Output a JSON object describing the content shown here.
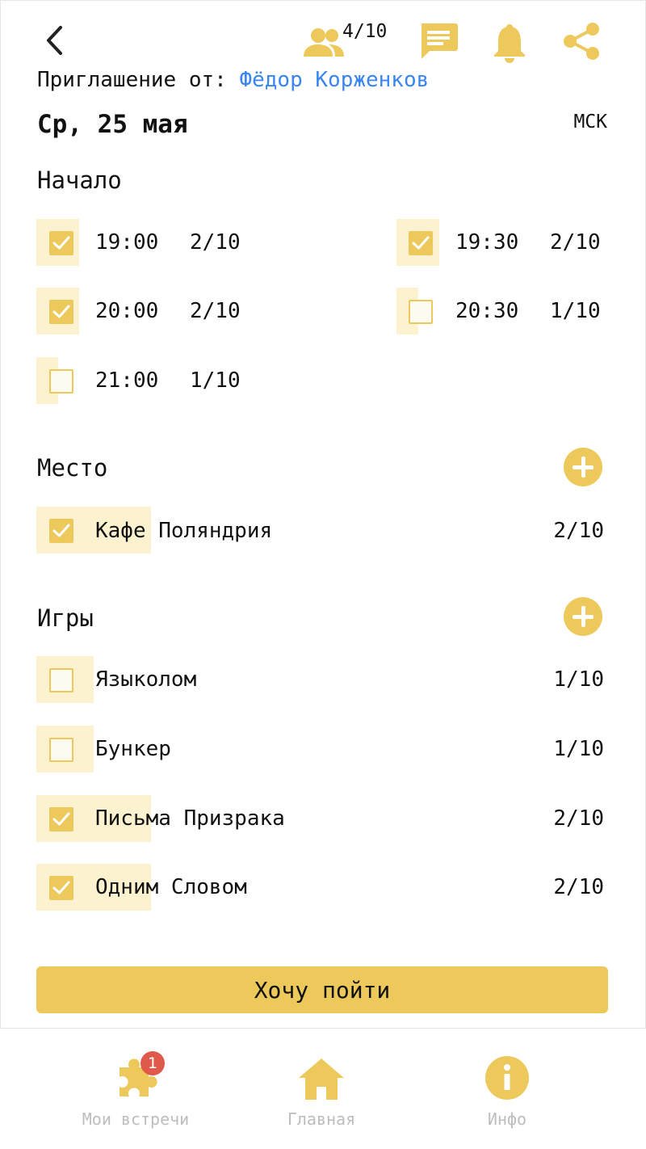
{
  "header": {
    "participants_count": "4/10",
    "icons": [
      "back-chevron-icon",
      "people-icon",
      "chat-icon",
      "bell-icon",
      "share-icon"
    ]
  },
  "invite": {
    "prefix": "Приглашение от:",
    "host": "Фёдор Корженков"
  },
  "event": {
    "date": "Ср, 25 мая",
    "timezone": "МСК"
  },
  "start": {
    "title": "Начало",
    "slots": [
      {
        "time": "19:00",
        "count": "2/10",
        "checked": true
      },
      {
        "time": "19:30",
        "count": "2/10",
        "checked": true
      },
      {
        "time": "20:00",
        "count": "2/10",
        "checked": true
      },
      {
        "time": "20:30",
        "count": "1/10",
        "checked": false
      },
      {
        "time": "21:00",
        "count": "1/10",
        "checked": false
      }
    ]
  },
  "place": {
    "title": "Место",
    "items": [
      {
        "name": "Кафе Поляндрия",
        "count": "2/10",
        "checked": true
      }
    ]
  },
  "games": {
    "title": "Игры",
    "items": [
      {
        "name": "Языколом",
        "count": "1/10",
        "checked": false
      },
      {
        "name": "Бункер",
        "count": "1/10",
        "checked": false
      },
      {
        "name": "Письма Призрака",
        "count": "2/10",
        "checked": true
      },
      {
        "name": "Одним Словом",
        "count": "2/10",
        "checked": true
      }
    ]
  },
  "action": {
    "label": "Хочу пойти"
  },
  "nav": {
    "items": [
      {
        "label": "Мои встречи",
        "icon": "puzzle-icon",
        "badge": "1"
      },
      {
        "label": "Главная",
        "icon": "home-icon"
      },
      {
        "label": "Инфо",
        "icon": "info-icon"
      }
    ]
  },
  "colors": {
    "accent": "#ECC95A",
    "highlight": "#FDF2CF",
    "link": "#3A86F0",
    "badge": "#E05A4B",
    "nav_label": "#BDBDBD"
  }
}
